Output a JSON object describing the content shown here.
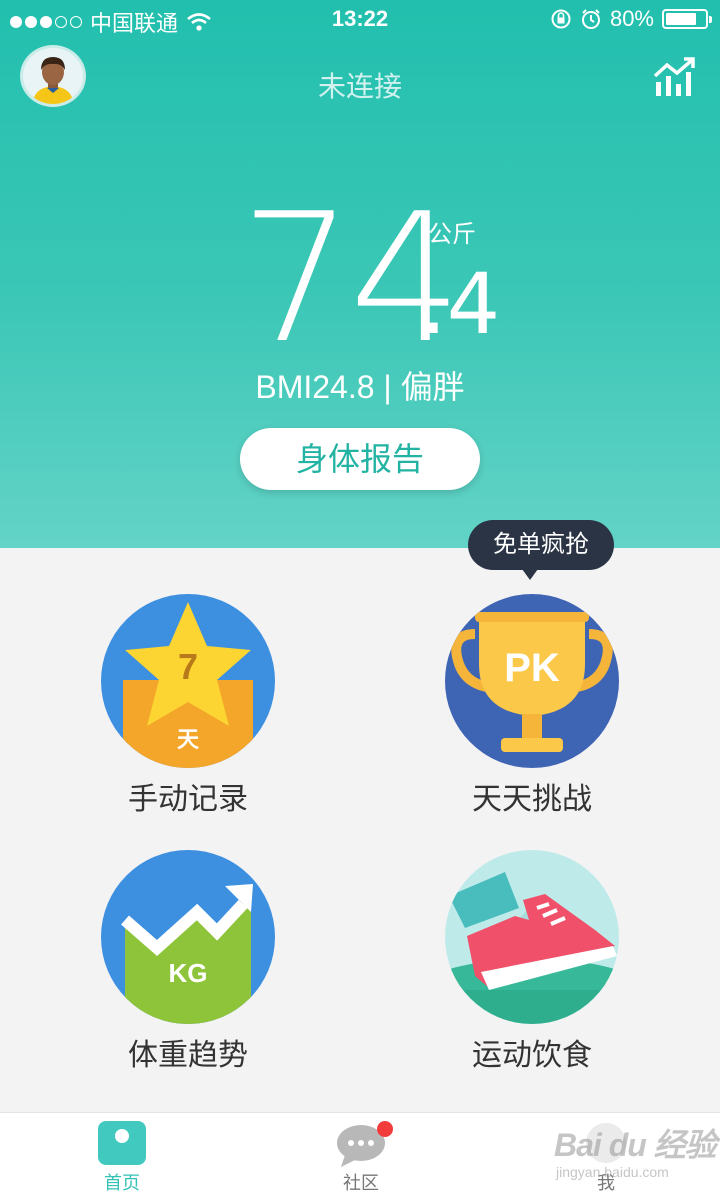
{
  "status_bar": {
    "carrier": "中国联通",
    "time": "13:22",
    "battery": "80%",
    "battery_level": 0.8,
    "signal_dots_filled": 3,
    "signal_dots_total": 5
  },
  "header": {
    "title": "未连接",
    "avatar_icon": "user-avatar",
    "trend_icon": "bar-chart-trend-icon"
  },
  "weight": {
    "integer": "74",
    "decimal": ".4",
    "unit": "公斤",
    "bmi_text": "BMI24.8 | 偏胖"
  },
  "report_button": "身体报告",
  "promo_bubble": "免单疯抢",
  "tiles": [
    {
      "label": "手动记录",
      "icon": "star-7-days-icon",
      "icon_text_top": "7",
      "icon_text_bottom": "天"
    },
    {
      "label": "天天挑战",
      "icon": "trophy-pk-icon",
      "icon_text": "PK"
    },
    {
      "label": "体重趋势",
      "icon": "weight-trend-kg-icon",
      "icon_text": "KG"
    },
    {
      "label": "运动饮食",
      "icon": "sneaker-icon"
    }
  ],
  "tabbar": {
    "tabs": [
      {
        "label": "首页",
        "icon": "home-scale-icon",
        "active": true
      },
      {
        "label": "社区",
        "icon": "chat-bubble-icon",
        "badge": true
      },
      {
        "label": "我",
        "icon": "profile-icon"
      }
    ]
  },
  "watermark": {
    "main": "Bai du 经验",
    "sub": "jingyan.baidu.com"
  },
  "colors": {
    "primary": "#22bfae",
    "accent_dark": "#2a3445",
    "badge": "#f23b3b"
  }
}
